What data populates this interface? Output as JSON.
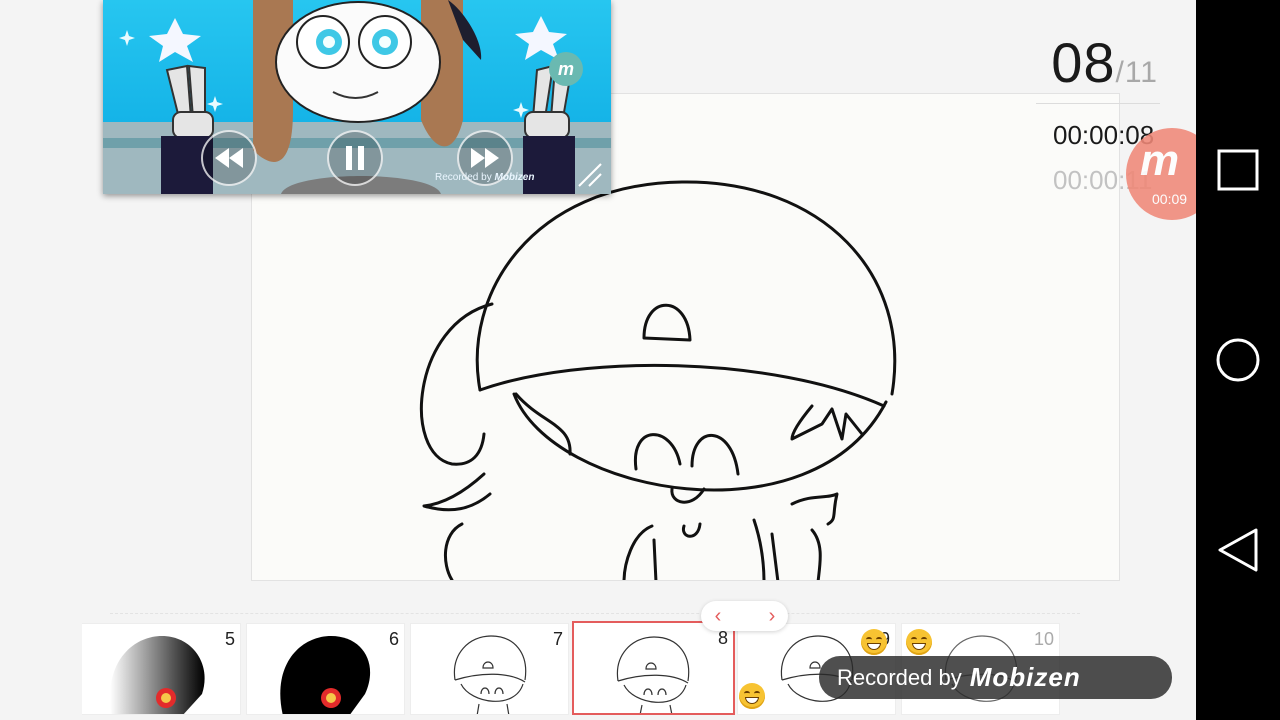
{
  "frame": {
    "current": "08",
    "separator": "/",
    "total": "11"
  },
  "time": {
    "current": "00:00:08",
    "total": "00:00:11"
  },
  "record_bubble": {
    "logo": "m",
    "time": "00:09"
  },
  "pip": {
    "recorded_text": "Recorded by",
    "brand": "Mobizen",
    "logo": "m",
    "logo_time": "00:09"
  },
  "strip": {
    "thumbnails": [
      {
        "number": "5"
      },
      {
        "number": "6"
      },
      {
        "number": "7"
      },
      {
        "number": "8"
      },
      {
        "number": "9"
      },
      {
        "number": "10"
      }
    ],
    "selected": "8",
    "prev_arrow": "‹",
    "next_arrow": "›"
  },
  "watermark": {
    "text": "Recorded by",
    "brand": "Mobizen"
  },
  "icons": {
    "recent_apps": "square-icon",
    "home": "circle-icon",
    "back": "triangle-back-icon",
    "rewind": "rewind-icon",
    "pause": "pause-icon",
    "fast_forward": "fast-forward-icon"
  },
  "colors": {
    "accent": "#e45c5c",
    "record": "#f08878",
    "nav_bar": "#000000"
  }
}
